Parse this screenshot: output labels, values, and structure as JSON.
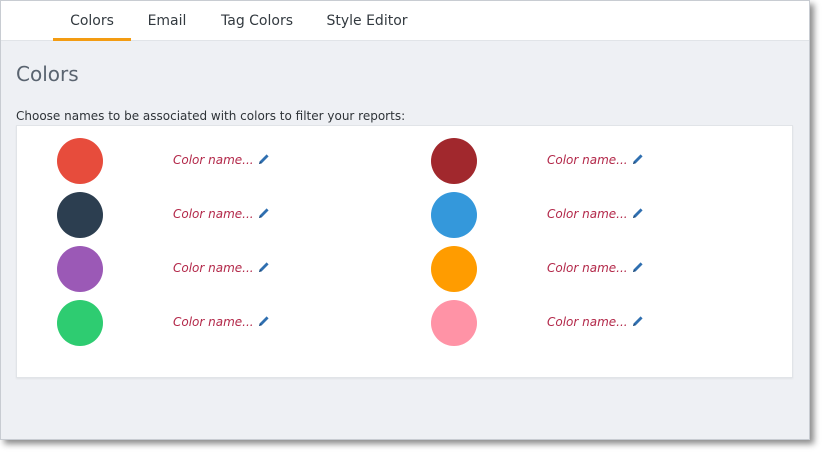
{
  "tabs": [
    {
      "label": "Colors",
      "active": true
    },
    {
      "label": "Email",
      "active": false
    },
    {
      "label": "Tag Colors",
      "active": false
    },
    {
      "label": "Style Editor",
      "active": false
    }
  ],
  "page": {
    "title": "Colors",
    "instructions": "Choose names to be associated with colors to filter your reports:"
  },
  "colors": [
    {
      "hex": "#e74c3c",
      "placeholder": "Color name...",
      "icon": "pencil-icon"
    },
    {
      "hex": "#a1282d",
      "placeholder": "Color name...",
      "icon": "pencil-icon"
    },
    {
      "hex": "#2c3e50",
      "placeholder": "Color name...",
      "icon": "pencil-icon"
    },
    {
      "hex": "#3498db",
      "placeholder": "Color name...",
      "icon": "pencil-icon"
    },
    {
      "hex": "#9b59b6",
      "placeholder": "Color name...",
      "icon": "pencil-icon"
    },
    {
      "hex": "#ff9c00",
      "placeholder": "Color name...",
      "icon": "pencil-icon"
    },
    {
      "hex": "#2ecc71",
      "placeholder": "Color name...",
      "icon": "pencil-icon"
    },
    {
      "hex": "#ff93a6",
      "placeholder": "Color name...",
      "icon": "pencil-icon"
    }
  ],
  "theme": {
    "accent": "#f39c12",
    "name_text": "#b3294a",
    "pencil": "#2f6fb0"
  }
}
